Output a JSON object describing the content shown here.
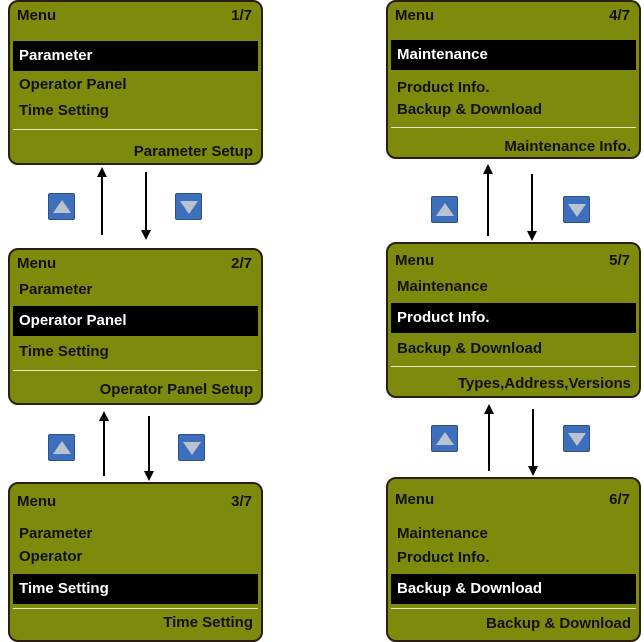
{
  "screens": [
    {
      "title": "Menu",
      "page": "1/7",
      "items": [
        "Parameter",
        "Operator Panel",
        "Time Setting"
      ],
      "selected": 0,
      "footer": "Parameter Setup"
    },
    {
      "title": "Menu",
      "page": "2/7",
      "items": [
        "Parameter",
        "Operator Panel",
        "Time Setting"
      ],
      "selected": 1,
      "footer": "Operator Panel Setup"
    },
    {
      "title": "Menu",
      "page": "3/7",
      "items": [
        "Parameter",
        "Operator",
        "Time Setting"
      ],
      "selected": 2,
      "footer": "Time Setting"
    },
    {
      "title": "Menu",
      "page": "4/7",
      "items": [
        "Maintenance",
        "Product Info.",
        "Backup & Download"
      ],
      "selected": 0,
      "footer": "Maintenance Info."
    },
    {
      "title": "Menu",
      "page": "5/7",
      "items": [
        "Maintenance",
        "Product Info.",
        "Backup & Download"
      ],
      "selected": 1,
      "footer": "Types,Address,Versions"
    },
    {
      "title": "Menu",
      "page": "6/7",
      "items": [
        "Maintenance",
        "Product Info.",
        "Backup & Download"
      ],
      "selected": 2,
      "footer": "Backup & Download"
    }
  ],
  "colors": {
    "screen_bg": "#7e8a0b",
    "button": "#3e6fbd",
    "button_glyph": "#b9c2cf"
  },
  "icons": [
    "up-arrow-button-icon",
    "down-arrow-button-icon"
  ]
}
